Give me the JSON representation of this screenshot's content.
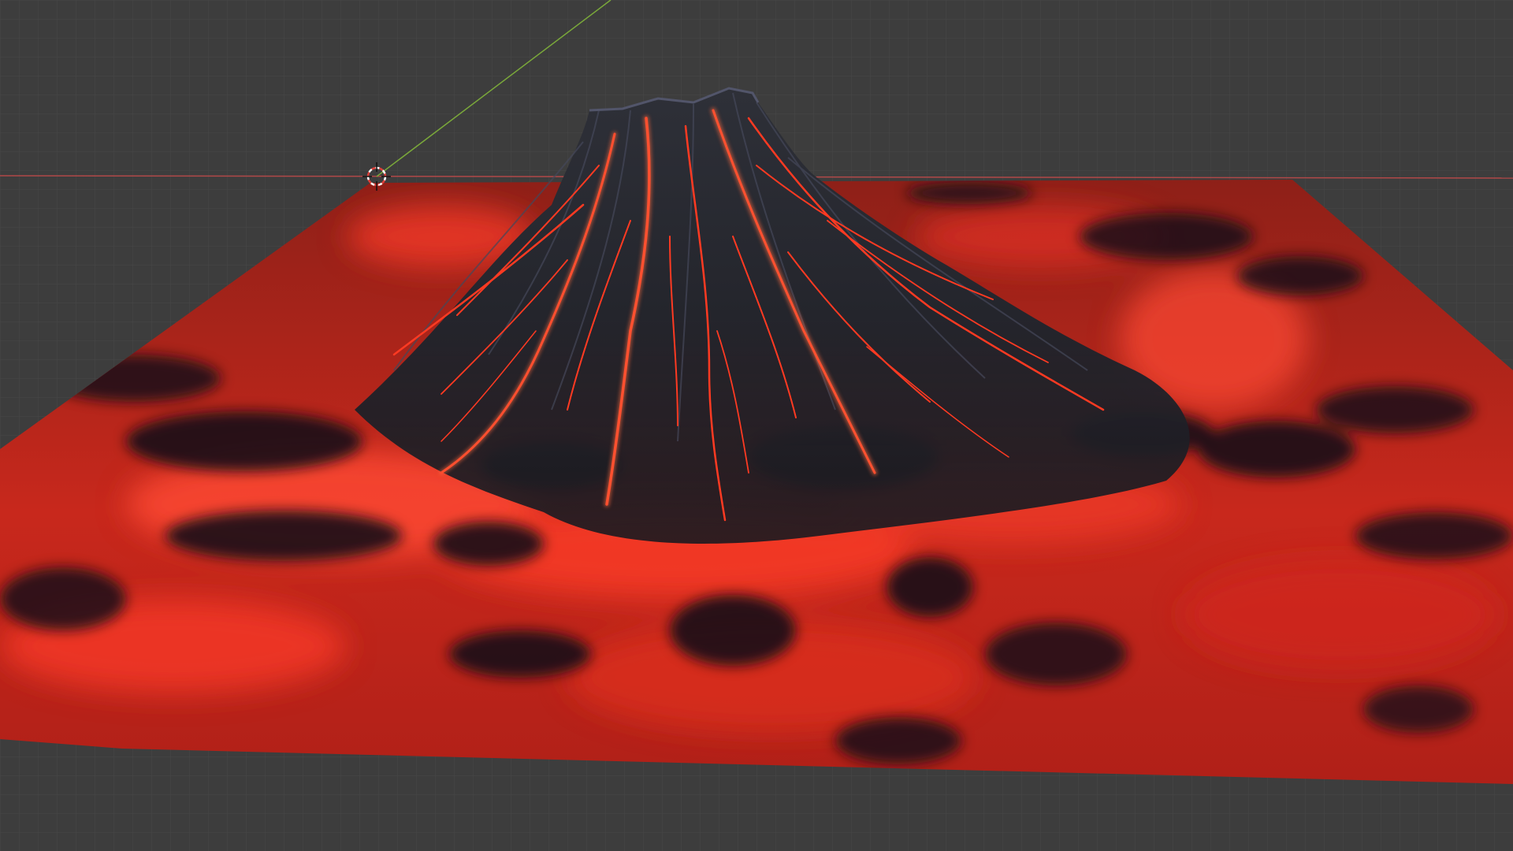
{
  "viewport": {
    "background_color": "#3d3d3d",
    "grid_color": "#4a4a4a",
    "x_axis_color": "#b04848",
    "y_axis_color": "#7aa83a"
  },
  "terrain": {
    "lava_color": "#d8261c",
    "lava_glow_color": "#ff4a30",
    "rock_color": "#1c1c22",
    "rock_highlight_color": "#3a3c46"
  },
  "cursor": {
    "icon": "3d-cursor-icon",
    "ring_color_a": "#ffffff",
    "ring_color_b": "#e0403a"
  }
}
